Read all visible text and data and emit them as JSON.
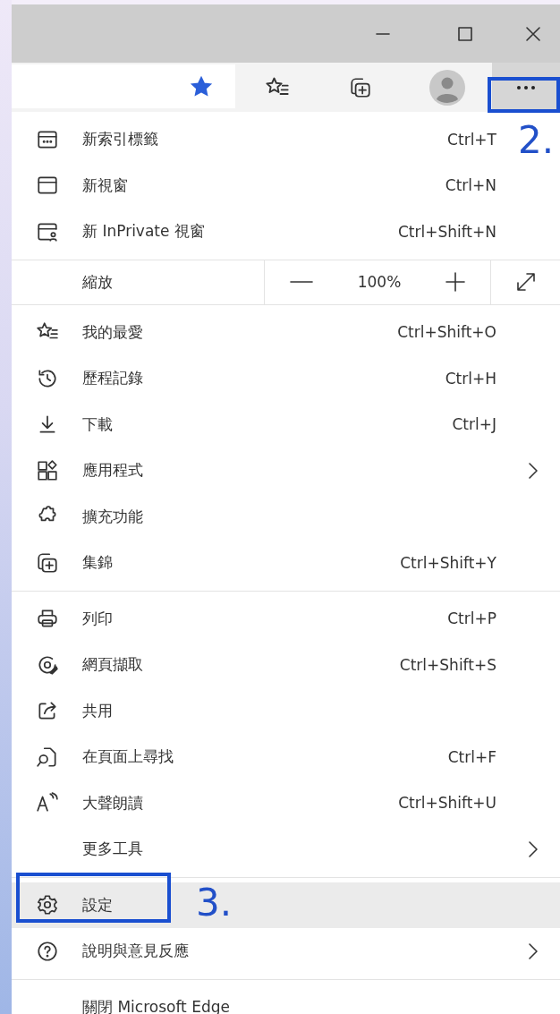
{
  "toolbar": {
    "favorited": true,
    "more_selected": true
  },
  "menu": {
    "groups": [
      {
        "items": [
          {
            "kind": "command",
            "label": "新索引標籤",
            "shortcut": "Ctrl+T",
            "submenu": false,
            "selected": false
          },
          {
            "kind": "command",
            "label": "新視窗",
            "shortcut": "Ctrl+N",
            "submenu": false,
            "selected": false
          },
          {
            "kind": "command",
            "label": "新 InPrivate 視窗",
            "shortcut": "Ctrl+Shift+N",
            "submenu": false,
            "selected": false
          }
        ]
      },
      {
        "items": [
          {
            "kind": "zoom",
            "label": "縮放",
            "value": "100%"
          }
        ]
      },
      {
        "items": [
          {
            "kind": "command",
            "label": "我的最愛",
            "shortcut": "Ctrl+Shift+O",
            "submenu": false,
            "selected": false
          },
          {
            "kind": "command",
            "label": "歷程記錄",
            "shortcut": "Ctrl+H",
            "submenu": false,
            "selected": false
          },
          {
            "kind": "command",
            "label": "下載",
            "shortcut": "Ctrl+J",
            "submenu": false,
            "selected": false
          },
          {
            "kind": "command",
            "label": "應用程式",
            "submenu": true,
            "selected": false
          },
          {
            "kind": "command",
            "label": "擴充功能",
            "submenu": false,
            "selected": false
          },
          {
            "kind": "command",
            "label": "集錦",
            "shortcut": "Ctrl+Shift+Y",
            "submenu": false,
            "selected": false
          }
        ]
      },
      {
        "items": [
          {
            "kind": "command",
            "label": "列印",
            "shortcut": "Ctrl+P",
            "submenu": false,
            "selected": false
          },
          {
            "kind": "command",
            "label": "網頁擷取",
            "shortcut": "Ctrl+Shift+S",
            "submenu": false,
            "selected": false
          },
          {
            "kind": "command",
            "label": "共用",
            "submenu": false,
            "selected": false
          },
          {
            "kind": "command",
            "label": "在頁面上尋找",
            "shortcut": "Ctrl+F",
            "submenu": false,
            "selected": false
          },
          {
            "kind": "command",
            "label": "大聲朗讀",
            "shortcut": "Ctrl+Shift+U",
            "submenu": false,
            "selected": false
          },
          {
            "kind": "command",
            "label": "更多工具",
            "submenu": true,
            "selected": false
          }
        ]
      },
      {
        "items": [
          {
            "kind": "command",
            "label": "設定",
            "submenu": false,
            "selected": true
          },
          {
            "kind": "command",
            "label": "說明與意見反應",
            "submenu": true,
            "selected": false
          }
        ]
      },
      {
        "items": [
          {
            "kind": "command",
            "label": "關閉 Microsoft Edge",
            "submenu": false,
            "selected": false
          }
        ]
      }
    ]
  },
  "annotations": [
    {
      "label": "2."
    },
    {
      "label": "3."
    }
  ]
}
